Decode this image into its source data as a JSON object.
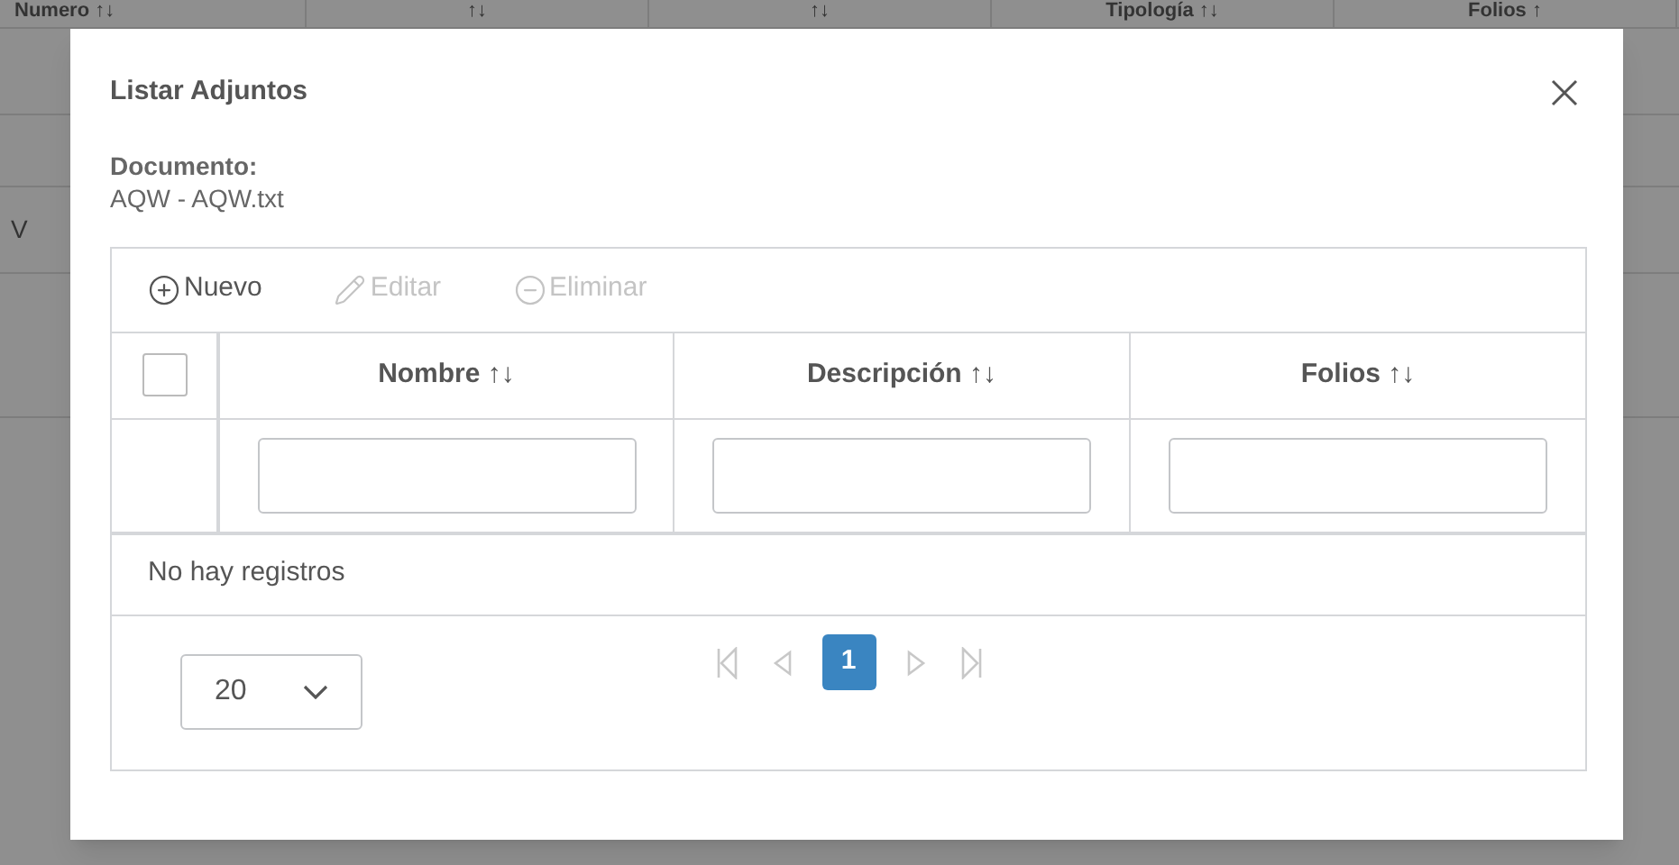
{
  "background_table": {
    "columns": [
      "Numero ↑↓",
      "↑↓",
      "↑↓",
      "Tipología ↑↓",
      "Folios ↑"
    ],
    "row_text": "V"
  },
  "dialog": {
    "title": "Listar Adjuntos",
    "document_label": "Documento:",
    "document_value": "AQW - AQW.txt",
    "toolbar": [
      {
        "kind": "add",
        "label": "Nuevo",
        "disabled": false
      },
      {
        "kind": "edit",
        "label": "Editar",
        "disabled": true
      },
      {
        "kind": "delete",
        "label": "Eliminar",
        "disabled": true
      }
    ],
    "select_all_checked": false,
    "columns": [
      {
        "label": "Nombre",
        "sort_icon": "↑↓"
      },
      {
        "label": "Descripción",
        "sort_icon": "↑↓"
      },
      {
        "label": "Folios",
        "sort_icon": "↑↓"
      }
    ],
    "empty_message": "No hay registros",
    "page_size": "20",
    "pager": {
      "first_disabled": true,
      "prev_disabled": true,
      "next_disabled": true,
      "last_disabled": true,
      "pages": [
        {
          "label": "1",
          "selected": true
        }
      ]
    }
  }
}
